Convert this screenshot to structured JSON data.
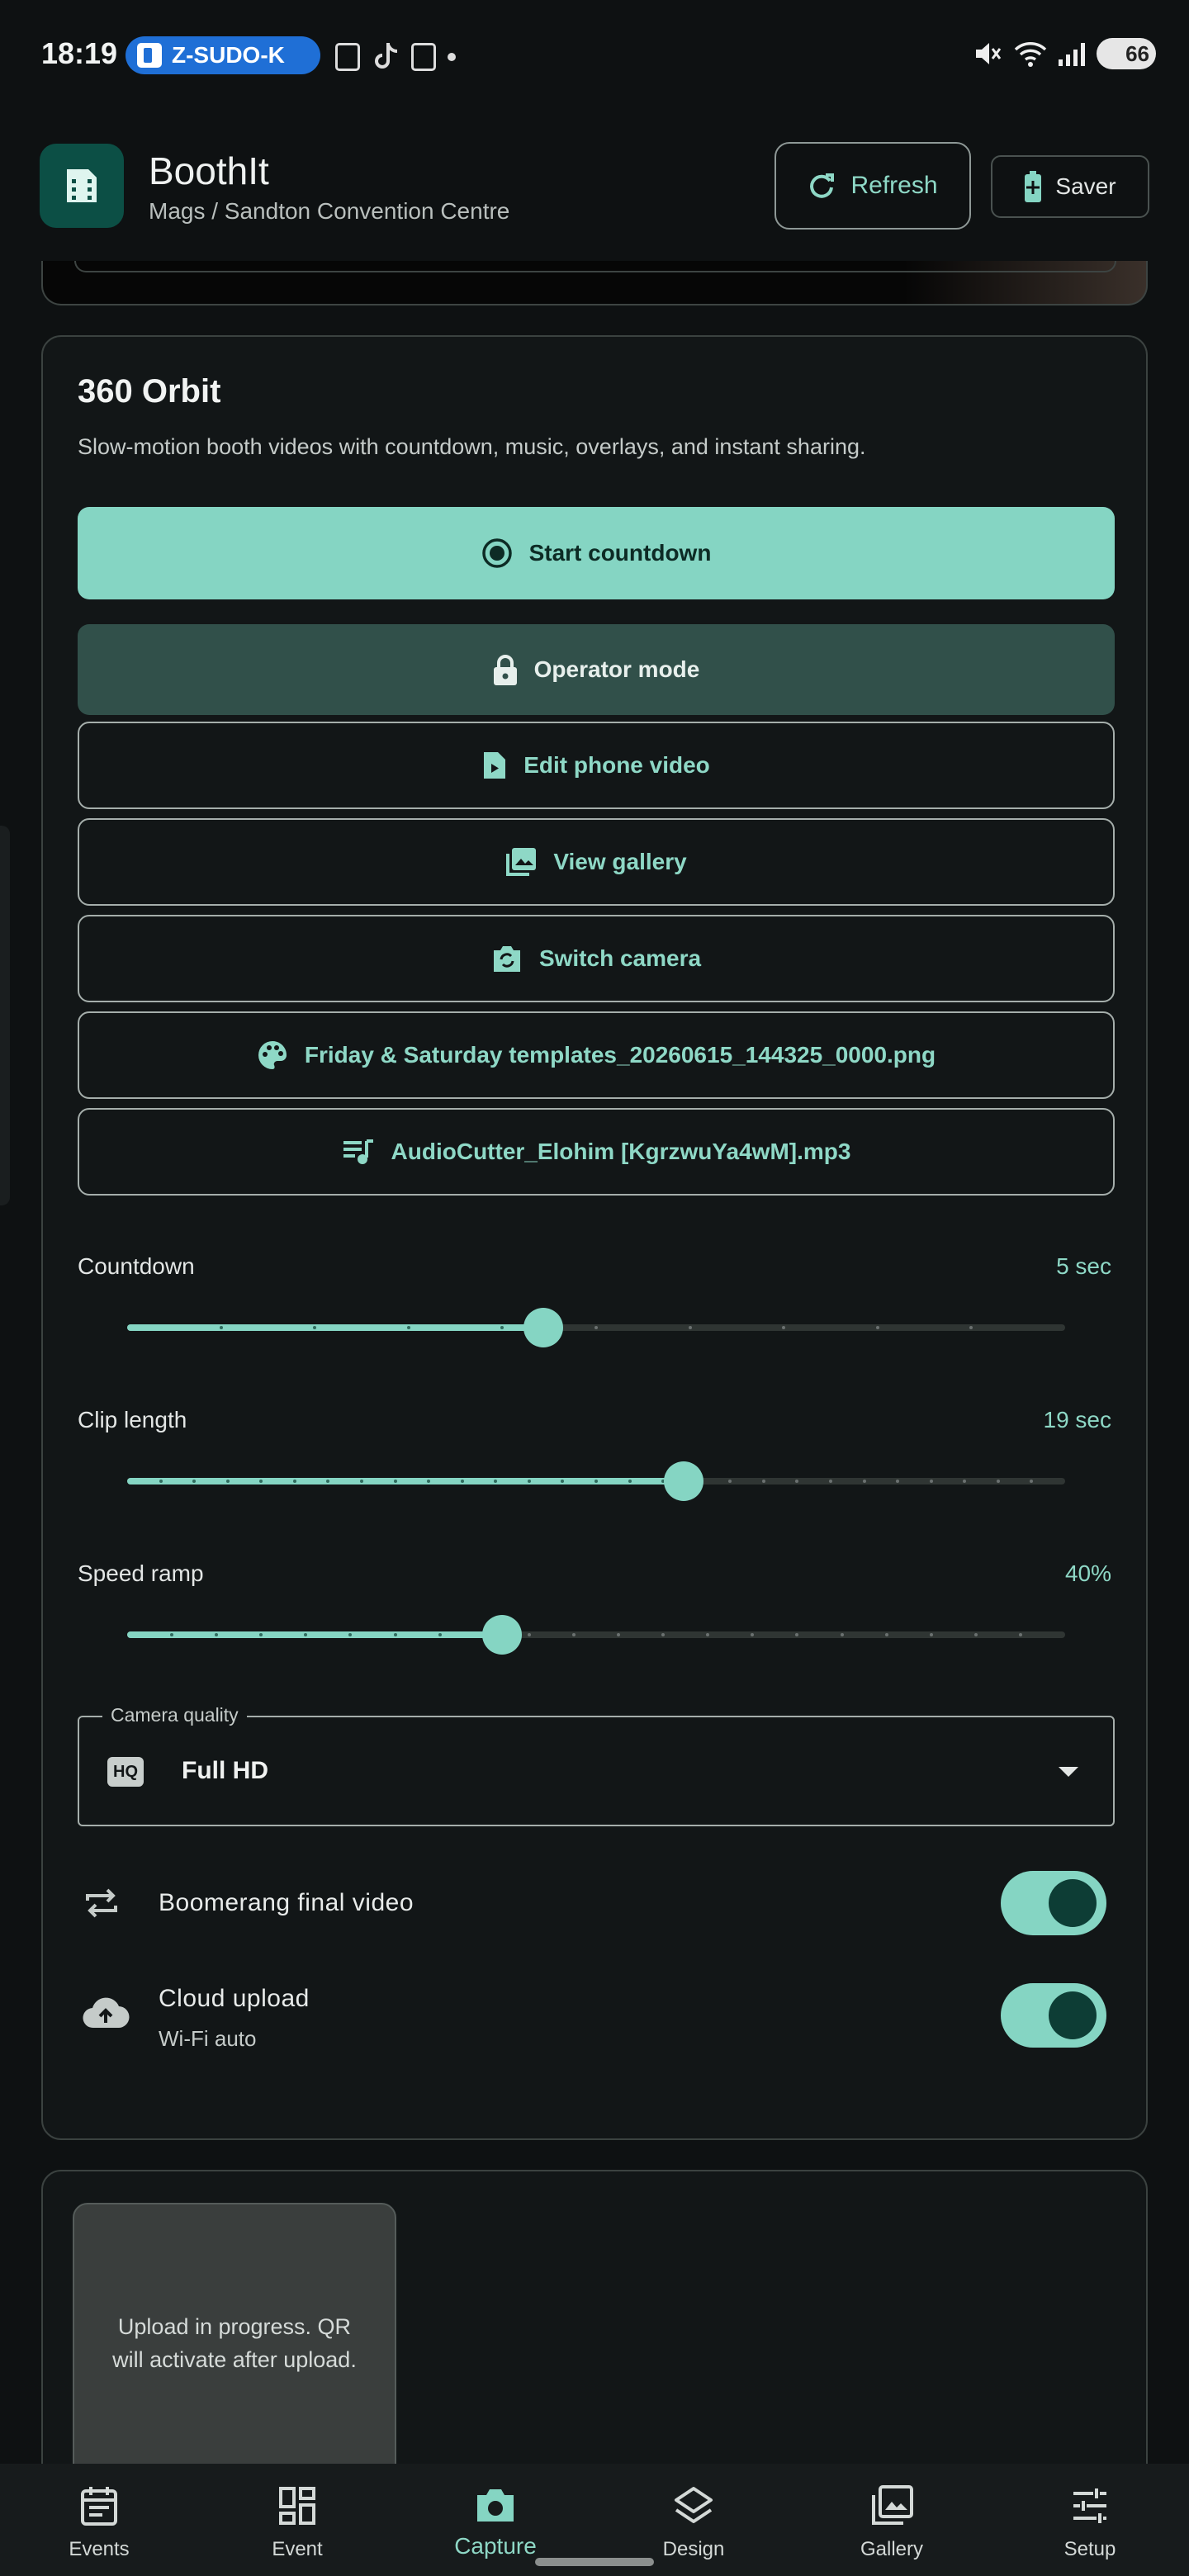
{
  "status_bar": {
    "time": "18:19",
    "notification_pill": "Z-SUDO-K",
    "battery": "66"
  },
  "app_bar": {
    "title": "BoothIt",
    "subtitle": "Mags / Sandton Convention Centre",
    "refresh_label": "Refresh",
    "saver_label": "Saver"
  },
  "mode_card": {
    "title": "360 Orbit",
    "description": "Slow-motion booth videos with countdown, music, overlays, and instant sharing.",
    "start_label": "Start countdown",
    "operator_label": "Operator mode",
    "edit_label": "Edit phone video",
    "gallery_label": "View gallery",
    "switch_camera_label": "Switch camera",
    "template_label": "Friday & Saturday templates_20260615_144325_0000.png",
    "audio_label": "AudioCutter_Elohim [KgrzwuYa4wM].mp3"
  },
  "sliders": {
    "countdown": {
      "label": "Countdown",
      "value_text": "5 sec",
      "fraction": 0.444,
      "ticks": 10
    },
    "clip_length": {
      "label": "Clip length",
      "value_text": "19 sec",
      "fraction": 0.593,
      "ticks": 28
    },
    "speed_ramp": {
      "label": "Speed ramp",
      "value_text": "40%",
      "fraction": 0.4,
      "ticks": 21
    }
  },
  "camera_quality": {
    "legend": "Camera quality",
    "icon_text": "HQ",
    "value": "Full HD"
  },
  "toggles": {
    "boomerang": {
      "label": "Boomerang final video",
      "on": true
    },
    "cloud": {
      "label": "Cloud upload",
      "sublabel": "Wi-Fi auto",
      "on": true
    }
  },
  "share_card": {
    "qr_message": "Upload in progress. QR will activate after upload."
  },
  "bottom_nav": [
    {
      "label": "Events",
      "icon": "calendar-icon"
    },
    {
      "label": "Event",
      "icon": "dashboard-icon"
    },
    {
      "label": "Capture",
      "icon": "camera-icon",
      "active": true
    },
    {
      "label": "Design",
      "icon": "layers-icon"
    },
    {
      "label": "Gallery",
      "icon": "photo-library-icon"
    },
    {
      "label": "Setup",
      "icon": "tune-icon"
    }
  ],
  "colors": {
    "accent": "#85d5c3",
    "accent_text": "#8ed8c6",
    "background": "#0e1112",
    "tonal": "#31504a"
  }
}
